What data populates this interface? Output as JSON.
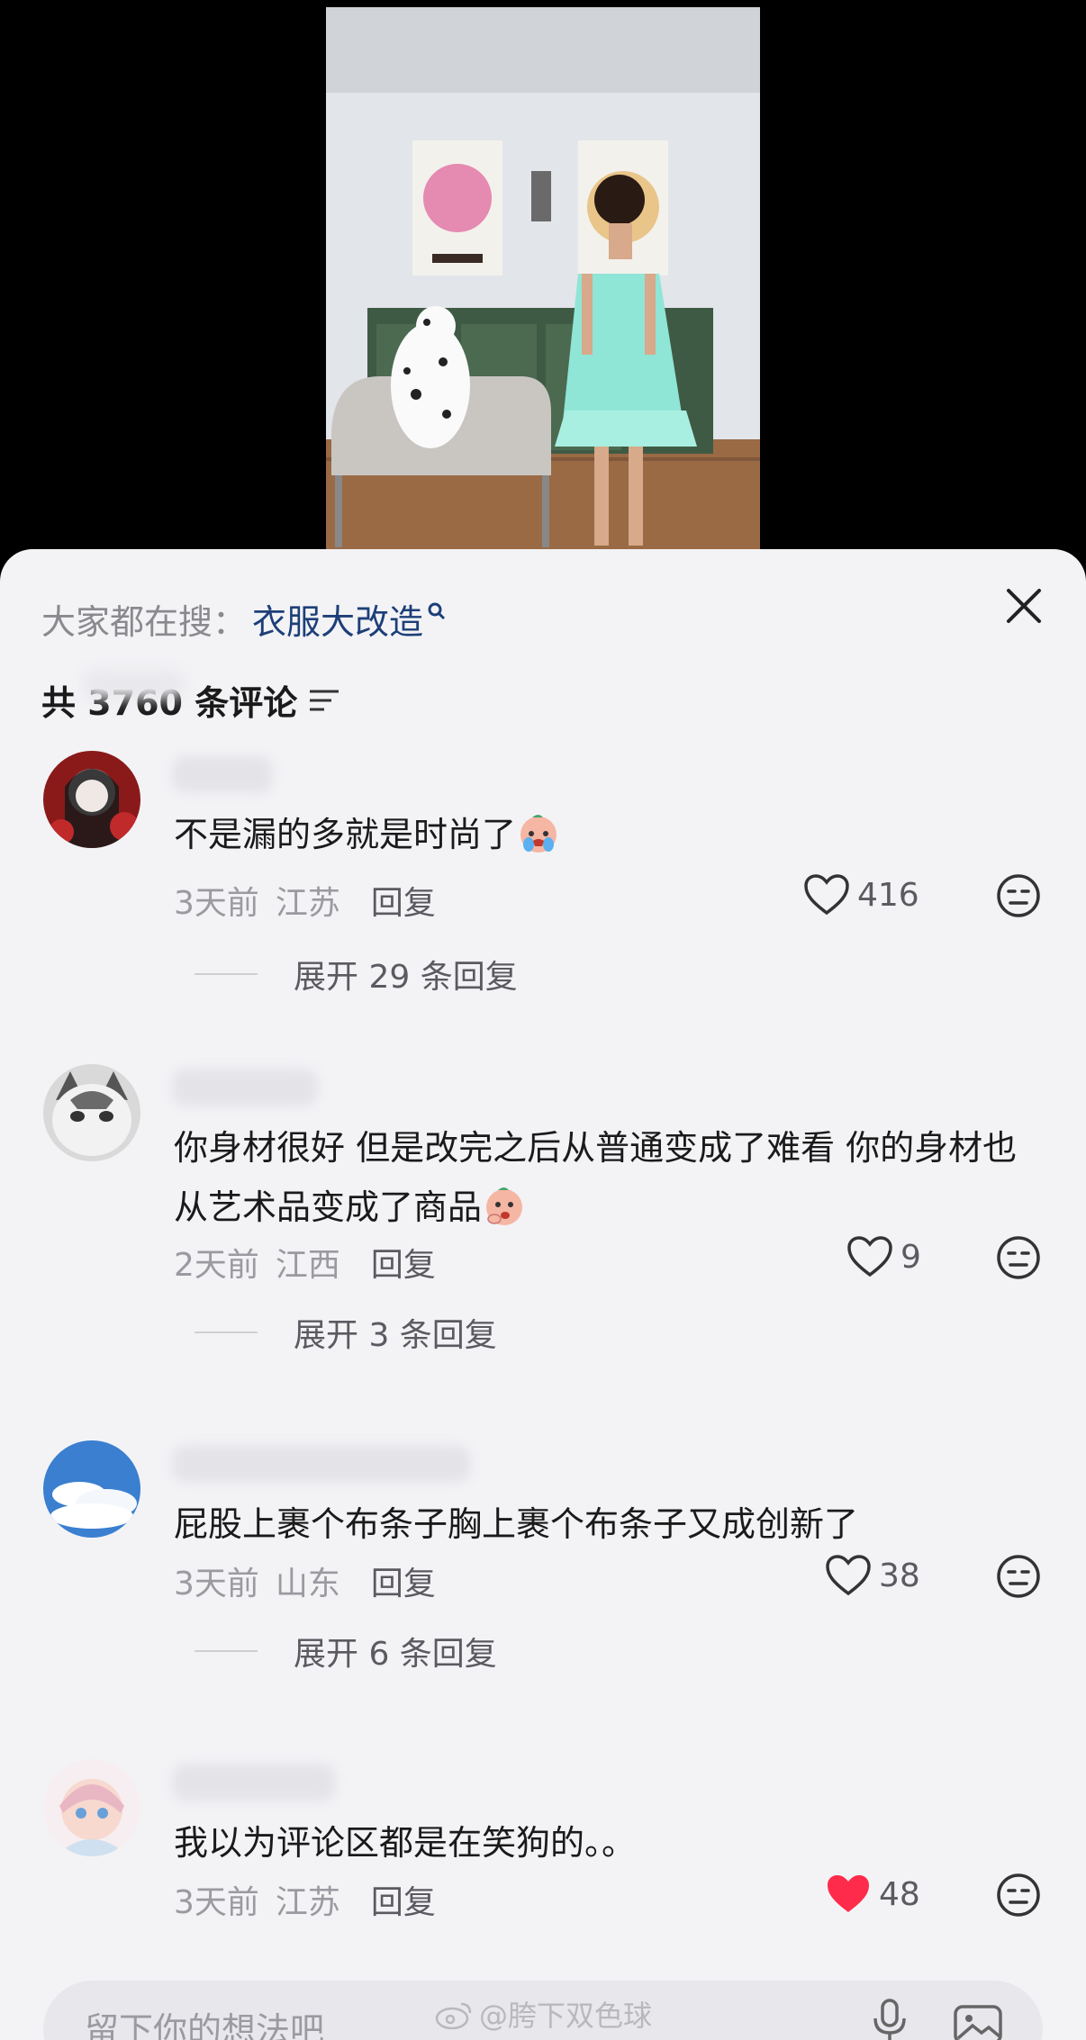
{
  "search": {
    "prefix": "大家都在搜：",
    "term": "衣服大改造"
  },
  "comments_header": {
    "count_label": "共 3760 条评论"
  },
  "comments": [
    {
      "text": "不是漏的多就是时尚了",
      "time": "3天前",
      "location": "江苏",
      "reply_label": "回复",
      "likes": "416",
      "liked": false,
      "expand_label": "展开 29 条回复"
    },
    {
      "text": "你身材很好 但是改完之后从普通变成了难看 你的身材也从艺术品变成了商品",
      "time": "2天前",
      "location": "江西",
      "reply_label": "回复",
      "likes": "9",
      "liked": false,
      "expand_label": "展开 3 条回复"
    },
    {
      "text": "屁股上裹个布条子胸上裹个布条子又成创新了",
      "time": "3天前",
      "location": "山东",
      "reply_label": "回复",
      "likes": "38",
      "liked": false,
      "expand_label": "展开 6 条回复"
    },
    {
      "text": "我以为评论区都是在笑狗的。。",
      "time": "3天前",
      "location": "江苏",
      "reply_label": "回复",
      "likes": "48",
      "liked": true
    }
  ],
  "input": {
    "placeholder": "留下你的想法吧"
  },
  "watermark": "@胯下双色球",
  "colors": {
    "liked": "#ff2b4a",
    "search_term": "#1d3f78",
    "sheet_bg": "#f3f3f6"
  }
}
